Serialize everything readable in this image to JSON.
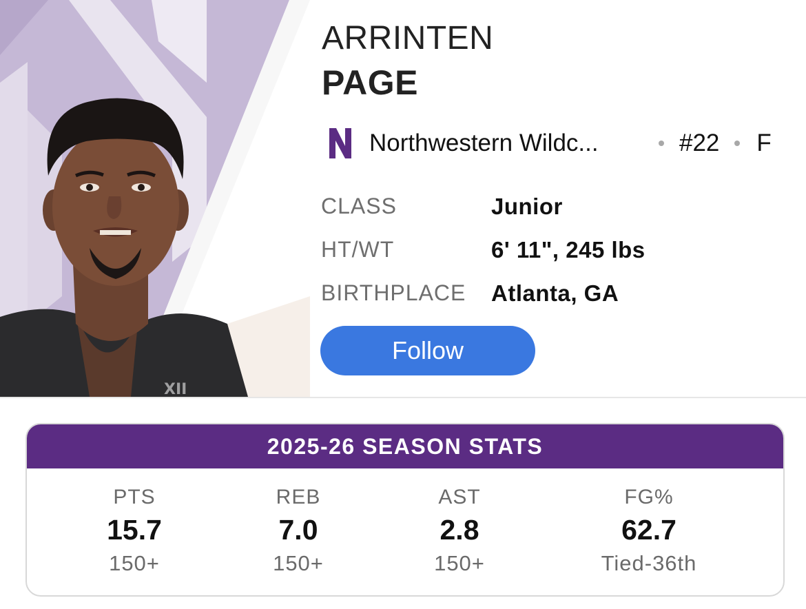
{
  "player": {
    "first_name": "ARRINTEN",
    "last_name": "PAGE",
    "team_name": "Northwestern Wildc...",
    "team_logo_letter": "N",
    "jersey": "#22",
    "position": "F"
  },
  "info": [
    {
      "label": "CLASS",
      "value": "Junior"
    },
    {
      "label": "HT/WT",
      "value": "6' 11\", 245 lbs"
    },
    {
      "label": "BIRTHPLACE",
      "value": "Atlanta, GA"
    }
  ],
  "follow_label": "Follow",
  "stats": {
    "title": "2025-26 SEASON STATS",
    "columns": [
      {
        "label": "PTS",
        "value": "15.7",
        "rank": "150+"
      },
      {
        "label": "REB",
        "value": "7.0",
        "rank": "150+"
      },
      {
        "label": "AST",
        "value": "2.8",
        "rank": "150+"
      },
      {
        "label": "FG%",
        "value": "62.7",
        "rank": "Tied-36th"
      }
    ]
  },
  "colors": {
    "team_purple": "#5b2c83",
    "panel_lavender": "#c5b8d6",
    "follow_blue": "#3a78e0",
    "label_gray": "#6e6e6e"
  },
  "icons": {
    "team_logo": "northwestern-n-logo-icon",
    "separator": "dot-separator-icon"
  }
}
